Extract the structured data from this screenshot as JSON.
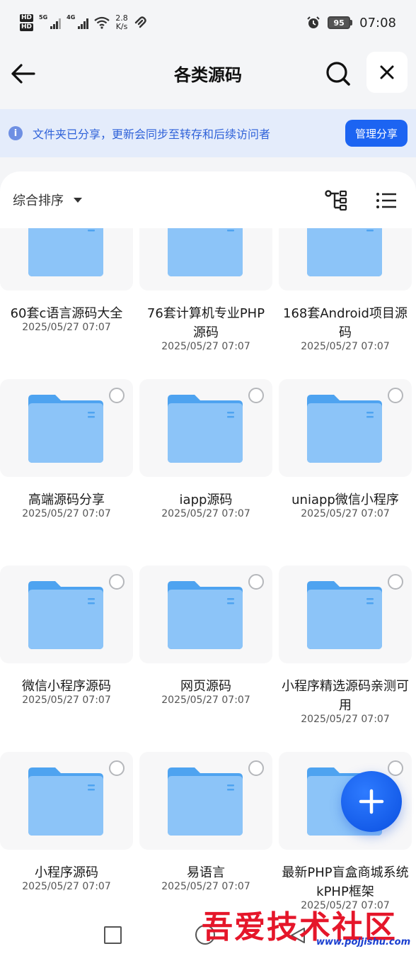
{
  "status_bar": {
    "hd1": "HD",
    "hd2": "HD",
    "net1": "5G",
    "net2": "4G",
    "speed_value": "2.8",
    "speed_unit": "K/s",
    "battery": "95",
    "time": "07:08"
  },
  "header": {
    "title": "各类源码"
  },
  "banner": {
    "info_glyph": "i",
    "text": "文件夹已分享，更新会同步至转存和后续访问者",
    "manage_label": "管理分享"
  },
  "toolbar": {
    "sort_label": "综合排序"
  },
  "colors": {
    "accent": "#1c64f2",
    "banner_bg": "#e4ecfb",
    "banner_text": "#2f62d9",
    "folder_back": "#4ea3f0",
    "folder_front": "#8cc4f8"
  },
  "items": [
    {
      "name": "60套c语言源码大全",
      "date": "2025/05/27 07:07"
    },
    {
      "name": "76套计算机专业PHP源码",
      "date": "2025/05/27 07:07"
    },
    {
      "name": "168套Android项目源码",
      "date": "2025/05/27 07:07"
    },
    {
      "name": "高端源码分享",
      "date": "2025/05/27 07:07"
    },
    {
      "name": "iapp源码",
      "date": "2025/05/27 07:07"
    },
    {
      "name": "uniapp微信小程序",
      "date": "2025/05/27 07:07"
    },
    {
      "name": "微信小程序源码",
      "date": "2025/05/27 07:07"
    },
    {
      "name": "网页源码",
      "date": "2025/05/27 07:07"
    },
    {
      "name": "小程序精选源码亲测可用",
      "date": "2025/05/27 07:07"
    },
    {
      "name": "小程序源码",
      "date": "2025/05/27 07:07"
    },
    {
      "name": "易语言",
      "date": "2025/05/27 07:07"
    },
    {
      "name": "最新PHP盲盒商城系统kPHP框架",
      "date": "2025/05/27 07:07"
    }
  ],
  "watermark": {
    "text": "吾爱技术社区",
    "url": "www.pojjishu.com"
  }
}
